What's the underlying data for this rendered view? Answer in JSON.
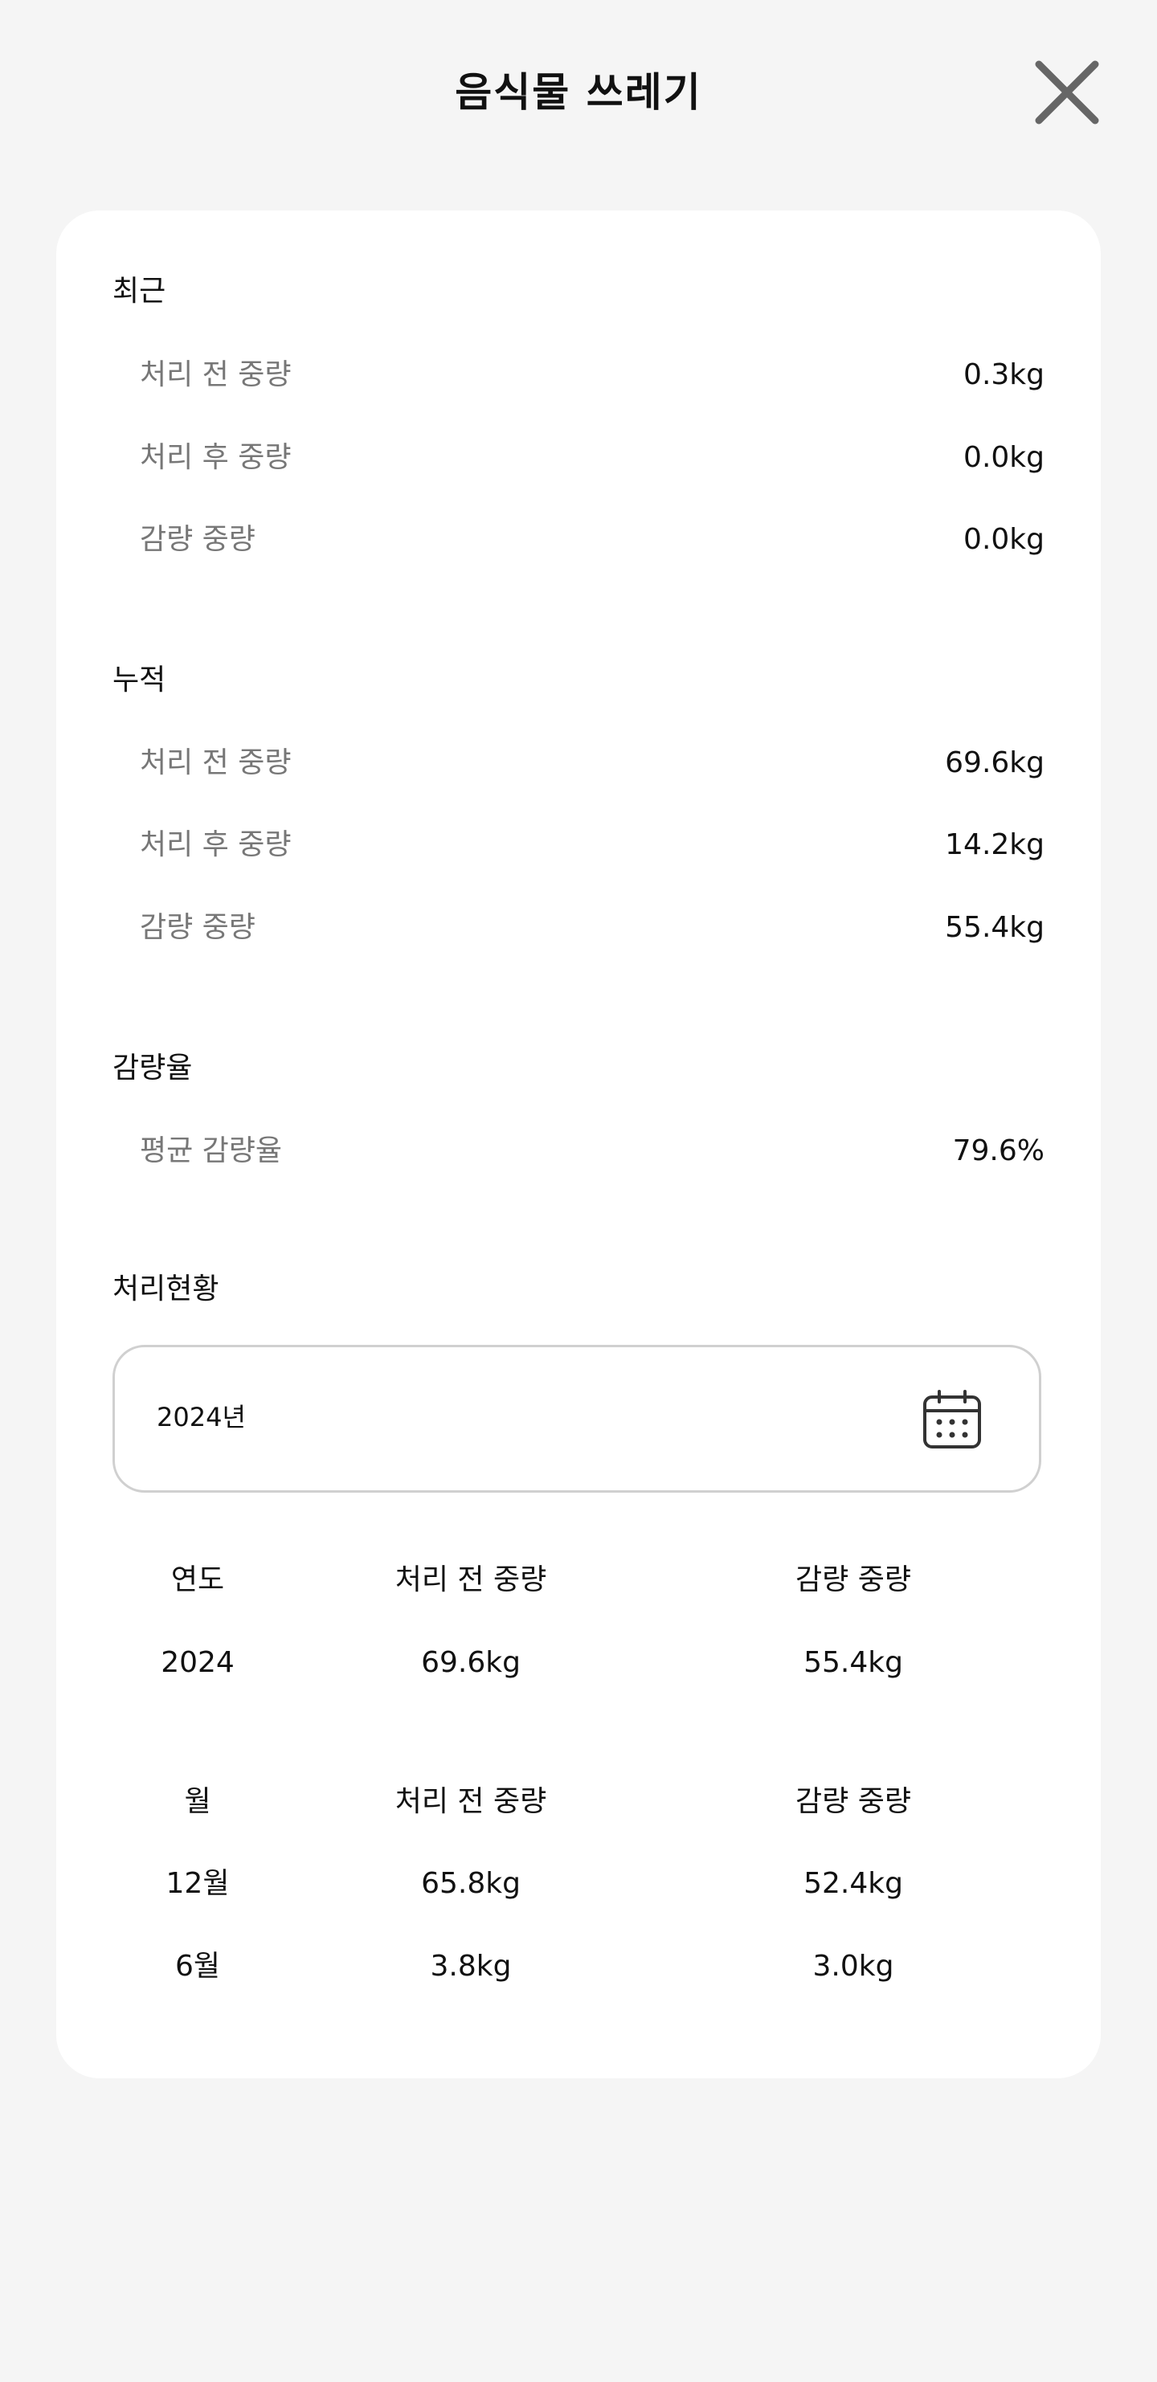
{
  "header": {
    "title": "음식물 쓰레기",
    "close_icon": "close-icon"
  },
  "recent": {
    "title": "최근",
    "rows": [
      {
        "label": "처리 전 중량",
        "value": "0.3kg"
      },
      {
        "label": "처리 후 중량",
        "value": "0.0kg"
      },
      {
        "label": "감량 중량",
        "value": "0.0kg"
      }
    ]
  },
  "cumulative": {
    "title": "누적",
    "rows": [
      {
        "label": "처리 전 중량",
        "value": "69.6kg"
      },
      {
        "label": "처리 후 중량",
        "value": "14.2kg"
      },
      {
        "label": "감량 중량",
        "value": "55.4kg"
      }
    ]
  },
  "reduction": {
    "title": "감량율",
    "rows": [
      {
        "label": "평균 감량율",
        "value": "79.6%"
      }
    ]
  },
  "status": {
    "title": "처리현황",
    "year_picker": {
      "value": "2024년",
      "icon": "calendar-icon"
    },
    "yearly_table": {
      "headers": [
        "연도",
        "처리 전 중량",
        "감량 중량"
      ],
      "rows": [
        [
          "2024",
          "69.6kg",
          "55.4kg"
        ]
      ]
    },
    "monthly_table": {
      "headers": [
        "월",
        "처리 전 중량",
        "감량 중량"
      ],
      "rows": [
        [
          "12월",
          "65.8kg",
          "52.4kg"
        ],
        [
          "6월",
          "3.8kg",
          "3.0kg"
        ]
      ]
    }
  },
  "colors": {
    "background": "#f5f5f5",
    "card": "#ffffff",
    "primary_text": "#111111",
    "secondary_text": "#777777",
    "border": "#d0d0d0",
    "close_icon": "#666666"
  }
}
